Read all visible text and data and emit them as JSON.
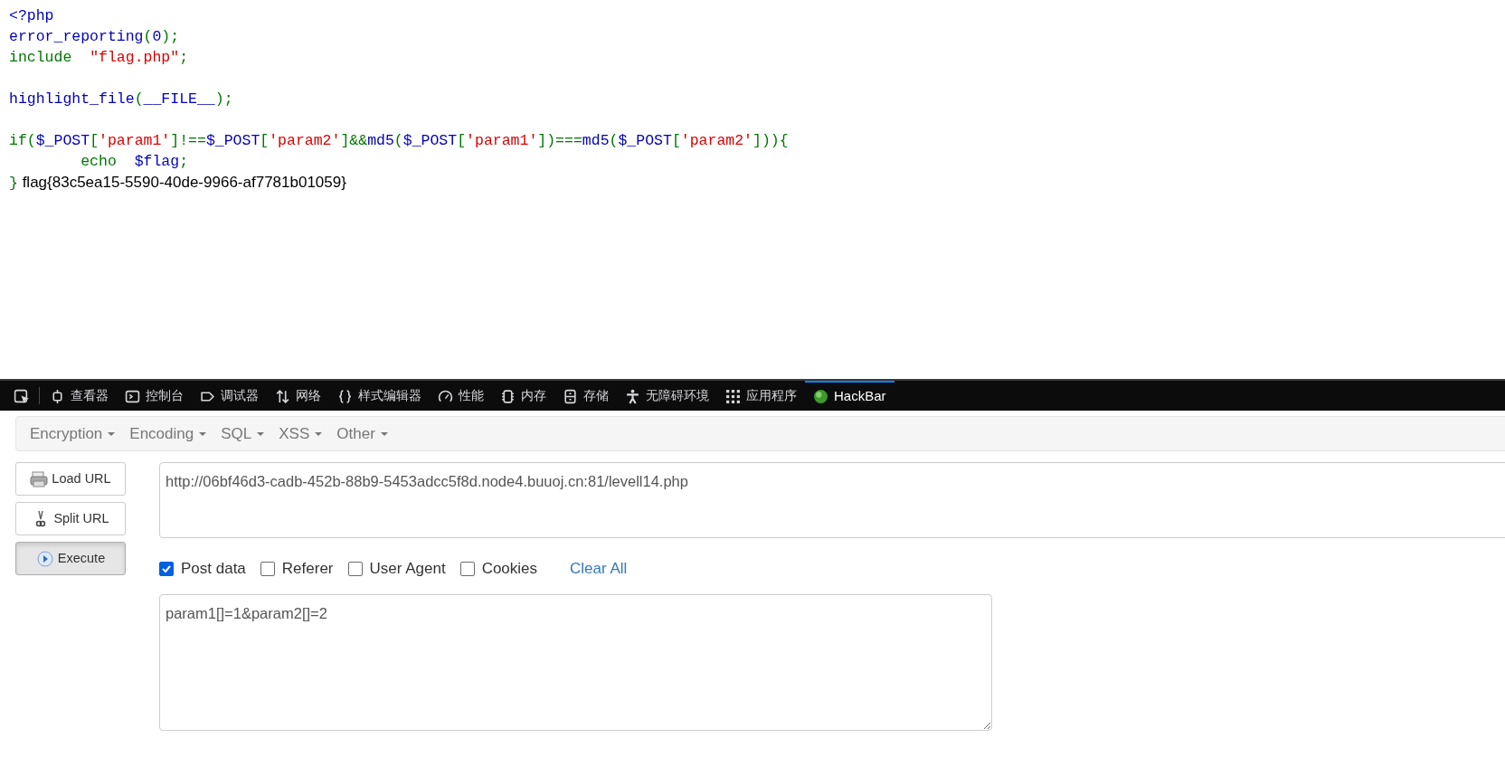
{
  "code": {
    "lines": [
      {
        "kind": "code",
        "tokens": [
          {
            "kind": "default",
            "text": "<?php"
          }
        ]
      },
      {
        "kind": "code",
        "tokens": [
          {
            "kind": "default",
            "text": "error_reporting"
          },
          {
            "kind": "keyword",
            "text": "("
          },
          {
            "kind": "default",
            "text": "0"
          },
          {
            "kind": "keyword",
            "text": ");"
          }
        ]
      },
      {
        "kind": "code",
        "tokens": [
          {
            "kind": "keyword",
            "text": "include  "
          },
          {
            "kind": "string",
            "text": "\"flag.php\""
          },
          {
            "kind": "keyword",
            "text": ";"
          }
        ]
      },
      {
        "kind": "blank"
      },
      {
        "kind": "code",
        "tokens": [
          {
            "kind": "default",
            "text": "highlight_file"
          },
          {
            "kind": "keyword",
            "text": "("
          },
          {
            "kind": "default",
            "text": "__FILE__"
          },
          {
            "kind": "keyword",
            "text": ");"
          }
        ]
      },
      {
        "kind": "blank"
      },
      {
        "kind": "code",
        "tokens": [
          {
            "kind": "keyword",
            "text": "if("
          },
          {
            "kind": "default",
            "text": "$_POST"
          },
          {
            "kind": "keyword",
            "text": "["
          },
          {
            "kind": "string",
            "text": "'param1'"
          },
          {
            "kind": "keyword",
            "text": "]!=="
          },
          {
            "kind": "default",
            "text": "$_POST"
          },
          {
            "kind": "keyword",
            "text": "["
          },
          {
            "kind": "string",
            "text": "'param2'"
          },
          {
            "kind": "keyword",
            "text": "]&&"
          },
          {
            "kind": "default",
            "text": "md5"
          },
          {
            "kind": "keyword",
            "text": "("
          },
          {
            "kind": "default",
            "text": "$_POST"
          },
          {
            "kind": "keyword",
            "text": "["
          },
          {
            "kind": "string",
            "text": "'param1'"
          },
          {
            "kind": "keyword",
            "text": "])==="
          },
          {
            "kind": "default",
            "text": "md5"
          },
          {
            "kind": "keyword",
            "text": "("
          },
          {
            "kind": "default",
            "text": "$_POST"
          },
          {
            "kind": "keyword",
            "text": "["
          },
          {
            "kind": "string",
            "text": "'param2'"
          },
          {
            "kind": "keyword",
            "text": "])){"
          }
        ]
      },
      {
        "kind": "code",
        "tokens": [
          {
            "kind": "keyword",
            "text": "        echo  "
          },
          {
            "kind": "default",
            "text": "$flag"
          },
          {
            "kind": "keyword",
            "text": ";"
          }
        ]
      },
      {
        "kind": "code",
        "tokens": [
          {
            "kind": "keyword",
            "text": "}"
          },
          {
            "kind": "output",
            "text": " flag{83c5ea15-5590-40de-9966-af7781b01059}"
          }
        ]
      }
    ]
  },
  "devtools": {
    "tabs": [
      {
        "selected": false
      },
      {
        "label": "查看器",
        "selected": false
      },
      {
        "label": "控制台",
        "selected": false
      },
      {
        "label": "调试器",
        "selected": false
      },
      {
        "label": "网络",
        "selected": false
      },
      {
        "label": "样式编辑器",
        "selected": false
      },
      {
        "label": "性能",
        "selected": false
      },
      {
        "label": "内存",
        "selected": false
      },
      {
        "label": "存储",
        "selected": false
      },
      {
        "label": "无障碍环境",
        "selected": false
      },
      {
        "label": "应用程序",
        "selected": false
      },
      {
        "label": "HackBar",
        "selected": true
      }
    ]
  },
  "hackbar": {
    "menus": [
      "Encryption",
      "Encoding",
      "SQL",
      "XSS",
      "Other"
    ],
    "buttons": [
      {
        "label": "Load URL",
        "active": false
      },
      {
        "label": "Split URL",
        "active": false
      },
      {
        "label": "Execute",
        "active": true
      }
    ],
    "url": "http://06bf46d3-cadb-452b-88b9-5453adcc5f8d.node4.buuoj.cn:81/levell14.php",
    "options": [
      {
        "label": "Post data",
        "checked": true
      },
      {
        "label": "Referer",
        "checked": false
      },
      {
        "label": "User Agent",
        "checked": false
      },
      {
        "label": "Cookies",
        "checked": false
      }
    ],
    "clear_link": "Clear All",
    "post_data": "param1[]=1&param2[]=2"
  }
}
